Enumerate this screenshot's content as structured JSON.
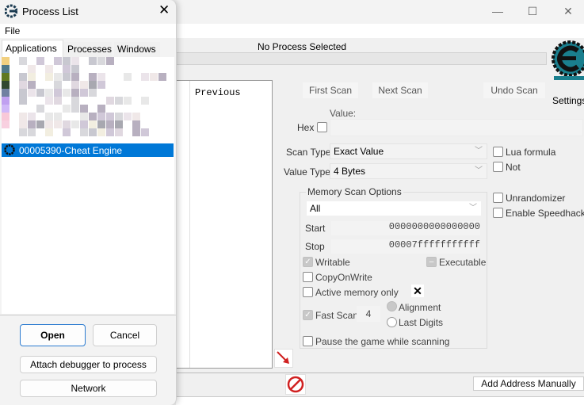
{
  "main_window": {
    "status": "No Process Selected",
    "list_header_previous": "Previous",
    "buttons": {
      "first_scan": "First Scan",
      "next_scan": "Next Scan",
      "undo_scan": "Undo Scan",
      "settings": "Settings",
      "add_address": "Add Address Manually"
    },
    "value_label": "Value:",
    "hex_label": "Hex",
    "scan_type_label": "Scan Type",
    "scan_type_value": "Exact Value",
    "value_type_label": "Value Type",
    "value_type_value": "4 Bytes",
    "lua_formula": "Lua formula",
    "not": "Not",
    "unrandomizer": "Unrandomizer",
    "enable_speedhack": "Enable Speedhack",
    "memory_scan_options": {
      "title": "Memory Scan Options",
      "region": "All",
      "start_label": "Start",
      "start_value": "0000000000000000",
      "stop_label": "Stop",
      "stop_value": "00007fffffffffff",
      "writable": "Writable",
      "executable": "Executable",
      "copy_on_write": "CopyOnWrite",
      "active_memory_only": "Active memory only",
      "fast_scan": "Fast Scan",
      "fast_scan_value": "4",
      "alignment": "Alignment",
      "last_digits": "Last Digits",
      "pause_game": "Pause the game while scanning"
    }
  },
  "process_dialog": {
    "title": "Process List",
    "menu_file": "File",
    "tabs": [
      "Applications",
      "Processes",
      "Windows"
    ],
    "selected_item": "00005390-Cheat Engine",
    "buttons": {
      "open": "Open",
      "cancel": "Cancel",
      "attach_debugger": "Attach debugger to process",
      "network": "Network"
    }
  },
  "colors": {
    "selection": "#0078d7",
    "logo": "#1a7f8e"
  }
}
